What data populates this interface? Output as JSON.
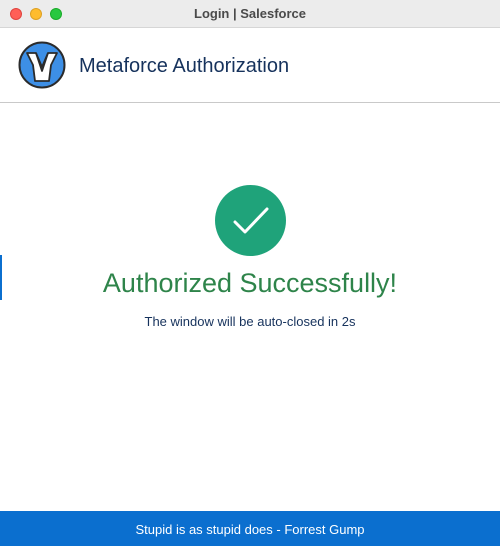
{
  "window": {
    "title": "Login | Salesforce",
    "controls": [
      "close",
      "minimize",
      "zoom"
    ]
  },
  "header": {
    "logo_icon": "metaforce-logo-icon",
    "title": "Metaforce Authorization"
  },
  "main": {
    "status_icon": "checkmark-icon",
    "title": "Authorized Successfully!",
    "subtitle": "The window will be auto-closed in 2s"
  },
  "footer": {
    "quote": "Stupid is as stupid does - Forrest Gump"
  },
  "colors": {
    "header_text": "#16325c",
    "success_green": "#2e844a",
    "check_circle": "#1fa37a",
    "footer_blue": "#0b6fcf",
    "logo_blue": "#3d8fe6"
  }
}
